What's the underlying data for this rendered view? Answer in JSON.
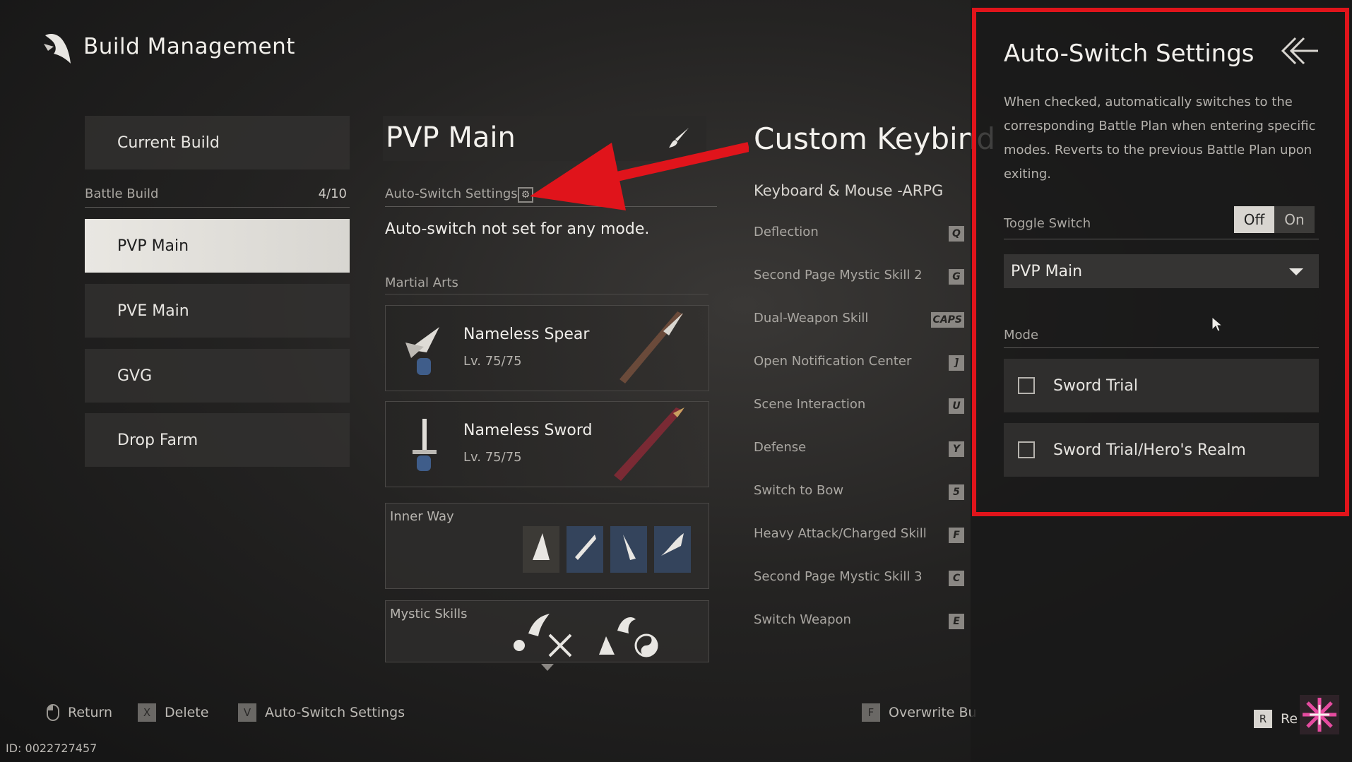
{
  "header": {
    "title": "Build Management"
  },
  "left": {
    "current_build": "Current Build",
    "battle_build_label": "Battle Build",
    "battle_build_count": "4/10",
    "builds": [
      "PVP Main",
      "PVE Main",
      "GVG",
      "Drop Farm"
    ]
  },
  "build": {
    "name": "PVP Main",
    "autoswitch_label": "Auto-Switch Settings",
    "autoswitch_status": "Auto-switch not set for any mode.",
    "martial_arts_label": "Martial Arts",
    "weapons": [
      {
        "name": "Nameless Spear",
        "level": "Lv. 75/75"
      },
      {
        "name": "Nameless Sword",
        "level": "Lv. 75/75"
      }
    ],
    "inner_way_label": "Inner Way",
    "mystic_skills_label": "Mystic Skills"
  },
  "keybinds": {
    "title": "Custom Keybind",
    "subtitle": "Keyboard & Mouse -ARPG",
    "rows": [
      {
        "label": "Deflection",
        "key": "Q"
      },
      {
        "label": "Second Page Mystic Skill 2",
        "key": "G"
      },
      {
        "label": "Dual-Weapon Skill",
        "key": "CAPS"
      },
      {
        "label": "Open Notification Center",
        "key": "]"
      },
      {
        "label": "Scene Interaction",
        "key": "U"
      },
      {
        "label": "Defense",
        "key": "Y"
      },
      {
        "label": "Switch to Bow",
        "key": "5"
      },
      {
        "label": "Heavy Attack/Charged Skill",
        "key": "F"
      },
      {
        "label": "Second Page Mystic Skill 3",
        "key": "C"
      },
      {
        "label": "Switch Weapon",
        "key": "E"
      }
    ]
  },
  "footer": {
    "return_label": "Return",
    "delete_key": "X",
    "delete_label": "Delete",
    "autoswitch_key": "V",
    "autoswitch_label": "Auto-Switch Settings",
    "overwrite_key": "F",
    "overwrite_label": "Overwrite Bu",
    "reset_key": "R",
    "reset_label": "Re",
    "user_id": "ID: 0022727457"
  },
  "panel": {
    "title": "Auto-Switch Settings",
    "description": "When checked, automatically switches to the corresponding Battle Plan when entering specific modes. Reverts to the previous Battle Plan upon exiting.",
    "toggle_label": "Toggle Switch",
    "toggle_off": "Off",
    "toggle_on": "On",
    "toggle_state": "Off",
    "plan_selected": "PVP Main",
    "mode_label": "Mode",
    "modes": [
      {
        "label": "Sword Trial",
        "checked": false
      },
      {
        "label": "Sword Trial/Hero's Realm",
        "checked": false
      }
    ]
  },
  "colors": {
    "annotation_red": "#e0141b",
    "active_build_bg": "#e9e7e2"
  },
  "icons": [
    "bird-logo-icon",
    "brush-icon",
    "gear-icon",
    "back-arrow-icon",
    "caret-down-icon",
    "mouse-icon",
    "cursor-icon"
  ]
}
